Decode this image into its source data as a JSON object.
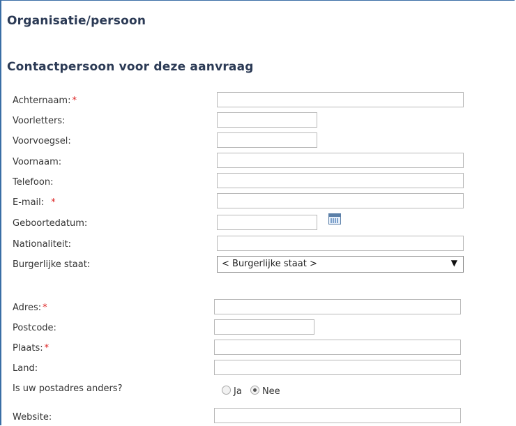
{
  "section_title": "Organisatie/persoon",
  "subsection_title": "Contactpersoon voor deze aanvraag",
  "required_marker": "*",
  "fields": {
    "achternaam": {
      "label": "Achternaam:",
      "value": ""
    },
    "voorletters": {
      "label": "Voorletters:",
      "value": ""
    },
    "voorvoegsel": {
      "label": "Voorvoegsel:",
      "value": ""
    },
    "voornaam": {
      "label": "Voornaam:",
      "value": ""
    },
    "telefoon": {
      "label": "Telefoon:",
      "value": ""
    },
    "email": {
      "label": "E-mail:",
      "value": ""
    },
    "geboortedatum": {
      "label": "Geboortedatum:",
      "value": ""
    },
    "nationaliteit": {
      "label": "Nationaliteit:",
      "value": ""
    },
    "burgerlijke_staat": {
      "label": "Burgerlijke staat:",
      "selected": "< Burgerlijke staat >"
    },
    "adres": {
      "label": "Adres:",
      "value": ""
    },
    "postcode": {
      "label": "Postcode:",
      "value": ""
    },
    "plaats": {
      "label": "Plaats:",
      "value": ""
    },
    "land": {
      "label": "Land:",
      "value": ""
    },
    "postadres_anders": {
      "label": "Is uw postadres anders?",
      "option_ja": "Ja",
      "option_nee": "Nee",
      "selected": "Nee"
    },
    "website": {
      "label": "Website:",
      "value": ""
    }
  },
  "icons": {
    "date_picker": "calendar-icon",
    "dropdown": "triangle-down"
  },
  "colors": {
    "heading": "#2b3a55",
    "required": "#dd2222",
    "frame": "#3a6ea5"
  }
}
